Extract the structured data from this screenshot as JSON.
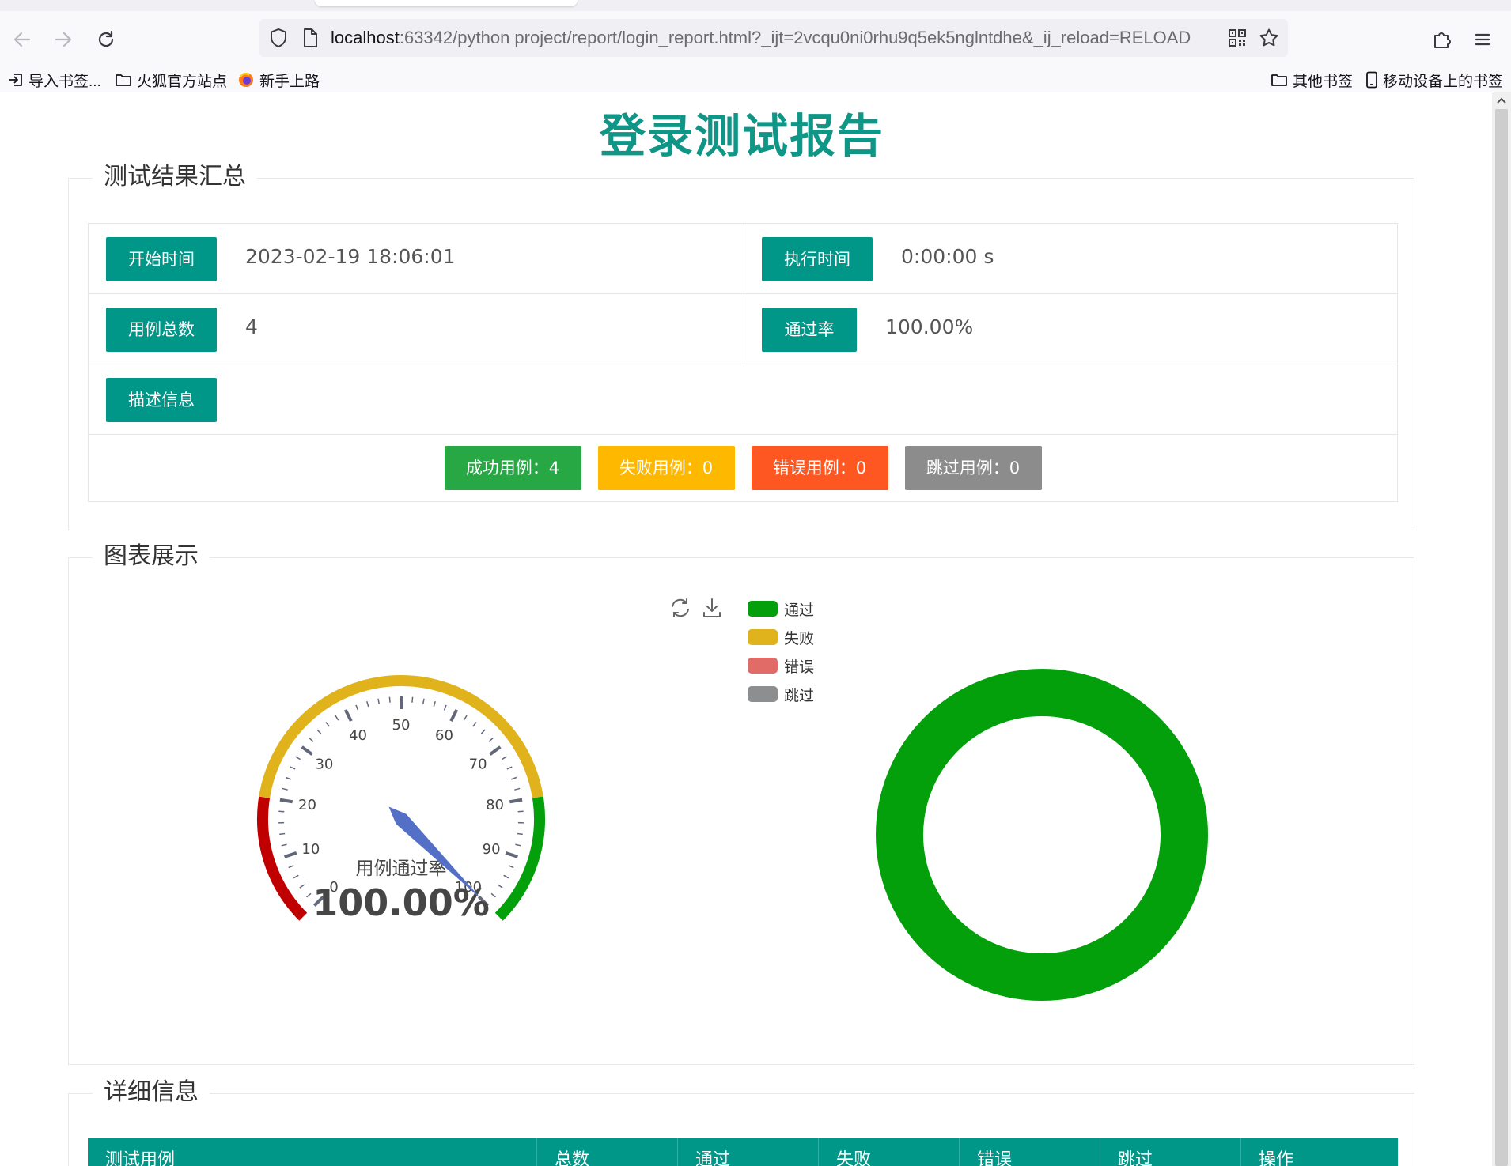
{
  "browser": {
    "url_host": "localhost",
    "url_rest": ":63342/python project/report/login_report.html?_ijt=2vcqu0ni0rhu9q5ek5nglntdhe&_ij_reload=RELOAD",
    "bookmarks": [
      {
        "label": "导入书签...",
        "icon": "import-icon"
      },
      {
        "label": "火狐官方站点",
        "icon": "folder-icon"
      },
      {
        "label": "新手上路",
        "icon": "firefox-icon"
      }
    ],
    "bookmarks_right": [
      {
        "label": "其他书签",
        "icon": "folder-icon"
      },
      {
        "label": "移动设备上的书签",
        "icon": "mobile-icon"
      }
    ]
  },
  "report": {
    "title": "登录测试报告",
    "summary_legend": "测试结果汇总",
    "start_time_label": "开始时间",
    "start_time": "2023-02-19 18:06:01",
    "exec_time_label": "执行时间",
    "exec_time": "0:00:00 s",
    "total_label": "用例总数",
    "total": "4",
    "pass_rate_label": "通过率",
    "pass_rate": "100.00%",
    "desc_label": "描述信息",
    "stats": [
      {
        "label": "成功用例：4",
        "color": "#28a745"
      },
      {
        "label": "失败用例：0",
        "color": "#ffb800"
      },
      {
        "label": "错误用例：0",
        "color": "#ff5722"
      },
      {
        "label": "跳过用例：0",
        "color": "#8c8c8c"
      }
    ],
    "chart_legend": "图表展示",
    "detail_legend": "详细信息",
    "detail_headers": [
      "测试用例",
      "总数",
      "通过",
      "失败",
      "错误",
      "跳过",
      "操作"
    ]
  },
  "chart_data": [
    {
      "type": "gauge",
      "title": "用例通过率",
      "value": 100,
      "value_label": "100.00%",
      "min": 0,
      "max": 100,
      "tick_labels": [
        "0",
        "10",
        "20",
        "30",
        "40",
        "50",
        "60",
        "70",
        "80",
        "90",
        "100"
      ],
      "bands": [
        {
          "from": 0,
          "to": 20,
          "color": "#c00000"
        },
        {
          "from": 20,
          "to": 80,
          "color": "#e0b31c"
        },
        {
          "from": 80,
          "to": 100,
          "color": "#04a00c"
        }
      ],
      "pointer_color": "#5470c6"
    },
    {
      "type": "pie",
      "donut": true,
      "legend": "top",
      "categories": [
        "通过",
        "失败",
        "错误",
        "跳过"
      ],
      "values": [
        4,
        0,
        0,
        0
      ],
      "colors": [
        "#04a00c",
        "#e0b31c",
        "#e16b66",
        "#8d8e90"
      ]
    }
  ]
}
